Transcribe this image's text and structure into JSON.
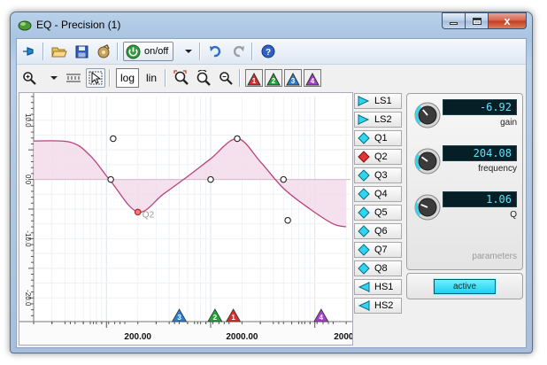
{
  "window": {
    "title": "EQ - Precision (1)",
    "close_glyph": "x"
  },
  "toolbar": {
    "onoff_label": "on/off"
  },
  "view_toolbar": {
    "log_label": "log",
    "lin_label": "lin",
    "band_buttons": [
      {
        "label": "1",
        "color": "#d92c2c"
      },
      {
        "label": "2",
        "color": "#21a43a"
      },
      {
        "label": "3",
        "color": "#2a7fd5"
      },
      {
        "label": "4",
        "color": "#a63fc9"
      }
    ]
  },
  "plot": {
    "x_tick_labels": [
      "200.00",
      "2000.00",
      "20000"
    ],
    "y_tick_labels": [
      "10.0",
      "0.0",
      "-10.0",
      "-20.0"
    ],
    "selected_point_label": "Q2",
    "fill_color": "#f3dbea",
    "curve_color": "#b8437e"
  },
  "chart_data": {
    "type": "line",
    "x_scale": "log",
    "x": [
      20,
      45,
      70,
      110,
      200,
      350,
      600,
      1000,
      1800,
      3000,
      5000,
      9000,
      15000,
      20000
    ],
    "series": [
      {
        "values": [
          6.5,
          6.3,
          4.0,
          -0.3,
          -5.5,
          -2.5,
          0.5,
          3.5,
          6.9,
          3.0,
          -1.5,
          -5.0,
          -7.5,
          -8.0
        ]
      }
    ],
    "ylim": [
      -24,
      14
    ],
    "grid": true,
    "handles": [
      {
        "name": "LS1",
        "freq": 110,
        "gain": 0.0
      },
      {
        "name": "",
        "freq": 116,
        "gain": 6.9
      },
      {
        "name": "Q2",
        "freq": 200,
        "gain": -5.5
      },
      {
        "name": "",
        "freq": 1000,
        "gain": 0.0
      },
      {
        "name": "",
        "freq": 1800,
        "gain": 6.9
      },
      {
        "name": "",
        "freq": 5000,
        "gain": 0.0
      },
      {
        "name": "",
        "freq": 5500,
        "gain": -6.9
      }
    ],
    "bottom_markers": [
      {
        "label": "3",
        "freq": 500,
        "color": "#2a7fd5"
      },
      {
        "label": "2",
        "freq": 1100,
        "color": "#21a43a"
      },
      {
        "label": "1",
        "freq": 1650,
        "color": "#d92c2c"
      },
      {
        "label": "4",
        "freq": 11500,
        "color": "#a63fc9"
      }
    ]
  },
  "bands": [
    {
      "label": "LS1",
      "icon": "low-shelf-icon",
      "selected": false
    },
    {
      "label": "LS2",
      "icon": "low-shelf-icon",
      "selected": false
    },
    {
      "label": "Q1",
      "icon": "peak-icon",
      "selected": false
    },
    {
      "label": "Q2",
      "icon": "peak-icon",
      "selected": true
    },
    {
      "label": "Q3",
      "icon": "peak-icon",
      "selected": false
    },
    {
      "label": "Q4",
      "icon": "peak-icon",
      "selected": false
    },
    {
      "label": "Q5",
      "icon": "peak-icon",
      "selected": false
    },
    {
      "label": "Q6",
      "icon": "peak-icon",
      "selected": false
    },
    {
      "label": "Q7",
      "icon": "peak-icon",
      "selected": false
    },
    {
      "label": "Q8",
      "icon": "peak-icon",
      "selected": false
    },
    {
      "label": "HS1",
      "icon": "high-shelf-icon",
      "selected": false
    },
    {
      "label": "HS2",
      "icon": "high-shelf-icon",
      "selected": false
    }
  ],
  "parameters": {
    "gain_value": "-6.92",
    "gain_label": "gain",
    "gain_level": 0.35,
    "frequency_value": "204.08",
    "frequency_label": "frequency",
    "frequency_level": 0.3,
    "q_value": "1.06",
    "q_label": "Q",
    "q_level": 0.25,
    "caption": "parameters"
  },
  "active_label": "active",
  "colors": {
    "accent": "#2fd6f2",
    "lcd_text": "#5fe6ff"
  }
}
